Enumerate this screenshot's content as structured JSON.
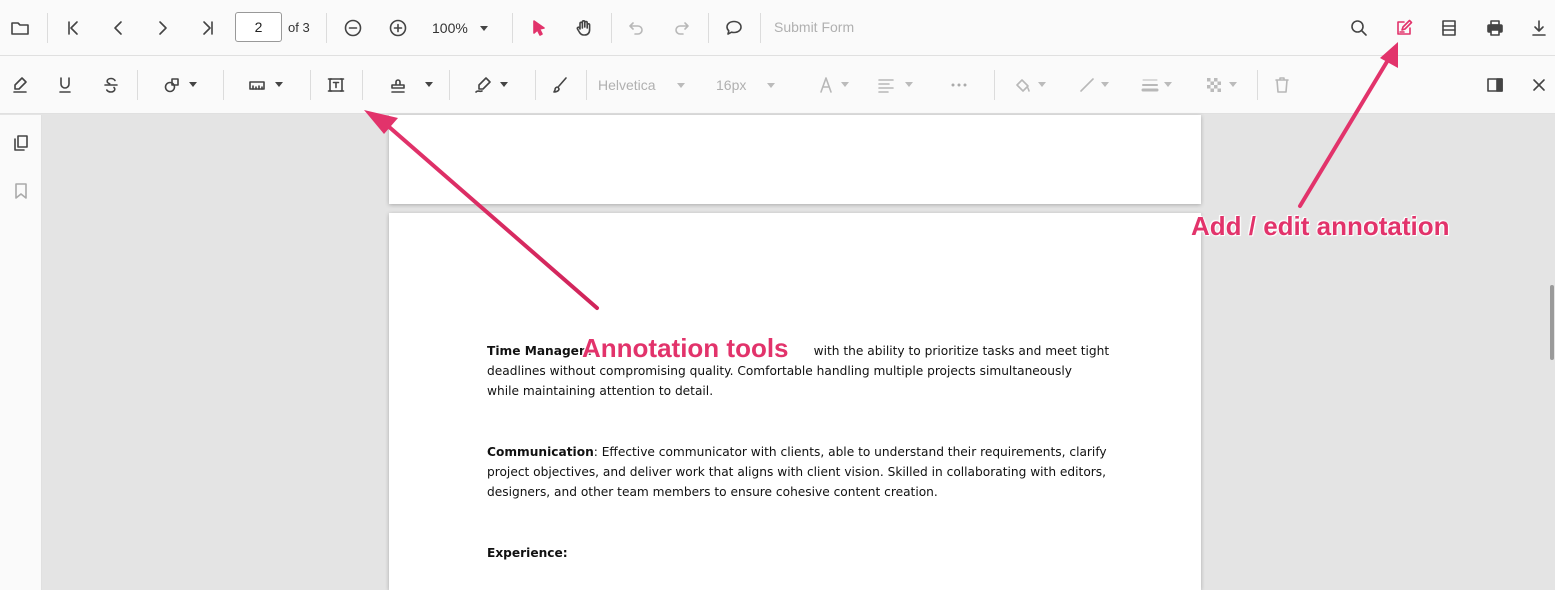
{
  "main_toolbar": {
    "page_number": "2",
    "page_total": "of 3",
    "zoom": "100%",
    "submit_form": "Submit Form"
  },
  "annot_toolbar": {
    "font_family": "Helvetica",
    "font_size": "16px"
  },
  "document": {
    "p1_bold": "Time Managem",
    "p1_line1_rest": "with the ability to prioritize tasks and meet tight",
    "p1_line2": "deadlines without compromising quality. Comfortable handling multiple projects simultaneously",
    "p1_line3": "while maintaining attention to detail.",
    "p2_bold": "Communication",
    "p2_line1_rest": ": Effective communicator with clients, able to understand their requirements, clarify",
    "p2_line2": "project objectives, and deliver work that aligns with client vision. Skilled in collaborating with editors,",
    "p2_line3": "designers, and other team members to ensure cohesive content creation.",
    "p3_bold": "Experience:"
  },
  "callouts": {
    "annotation_tools": "Annotation tools",
    "add_edit": "Add / edit annotation"
  },
  "colors": {
    "accent": "#e2336b",
    "icon": "#444444",
    "disabled": "#b8b8b8"
  }
}
